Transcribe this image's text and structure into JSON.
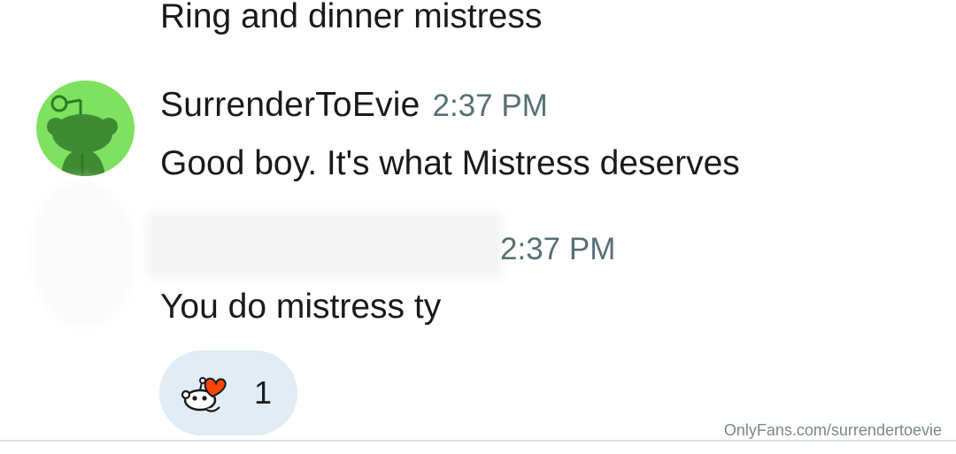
{
  "previous_message": {
    "text": "Ring and dinner mistress"
  },
  "messages": [
    {
      "username": "SurrenderToEvie",
      "timestamp": "2:37 PM",
      "body": "Good boy. It's what Mistress deserves",
      "avatar_color": "#7ee15f"
    },
    {
      "username": "",
      "timestamp": "2:37 PM",
      "body": "You do mistress ty"
    }
  ],
  "reaction": {
    "icon": "snoo-heart-icon",
    "count": "1",
    "pill_color": "#e1ecf4"
  },
  "watermark": "OnlyFans.com/surrendertoevie"
}
